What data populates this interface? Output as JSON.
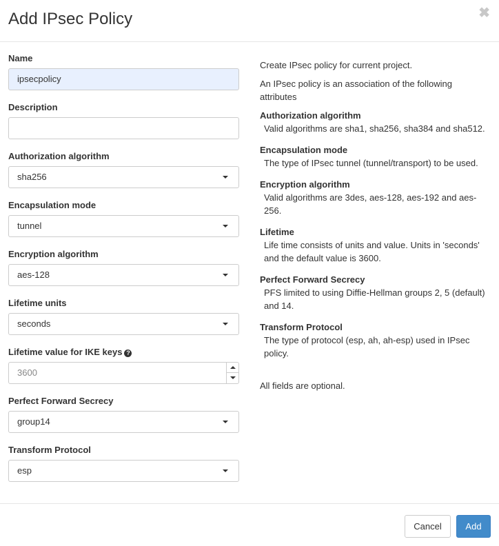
{
  "modal": {
    "title": "Add IPsec Policy",
    "close_icon": "times-icon"
  },
  "form": {
    "name": {
      "label": "Name",
      "value": "ipsecpolicy"
    },
    "description": {
      "label": "Description",
      "value": ""
    },
    "auth_algorithm": {
      "label": "Authorization algorithm",
      "value": "sha256"
    },
    "encapsulation_mode": {
      "label": "Encapsulation mode",
      "value": "tunnel"
    },
    "encryption_algorithm": {
      "label": "Encryption algorithm",
      "value": "aes-128"
    },
    "lifetime_units": {
      "label": "Lifetime units",
      "value": "seconds"
    },
    "lifetime_value": {
      "label": "Lifetime value for IKE keys",
      "placeholder": "3600",
      "help_icon": "question-circle-icon"
    },
    "pfs": {
      "label": "Perfect Forward Secrecy",
      "value": "group14"
    },
    "transform_protocol": {
      "label": "Transform Protocol",
      "value": "esp"
    }
  },
  "help": {
    "intro": "Create IPsec policy for current project.",
    "intro2": "An IPsec policy is an association of the following attributes",
    "items": [
      {
        "heading": "Authorization algorithm",
        "text": "Valid algorithms are sha1, sha256, sha384 and sha512."
      },
      {
        "heading": "Encapsulation mode",
        "text": "The type of IPsec tunnel (tunnel/transport) to be used."
      },
      {
        "heading": "Encryption algorithm",
        "text": "Valid algorithms are 3des, aes-128, aes-192 and aes-256."
      },
      {
        "heading": "Lifetime",
        "text": "Life time consists of units and value. Units in 'seconds' and the default value is 3600."
      },
      {
        "heading": "Perfect Forward Secrecy",
        "text": "PFS limited to using Diffie-Hellman groups 2, 5 (default) and 14."
      },
      {
        "heading": "Transform Protocol",
        "text": "The type of protocol (esp, ah, ah-esp) used in IPsec policy."
      }
    ],
    "footer_note": "All fields are optional."
  },
  "footer": {
    "cancel_label": "Cancel",
    "add_label": "Add"
  }
}
